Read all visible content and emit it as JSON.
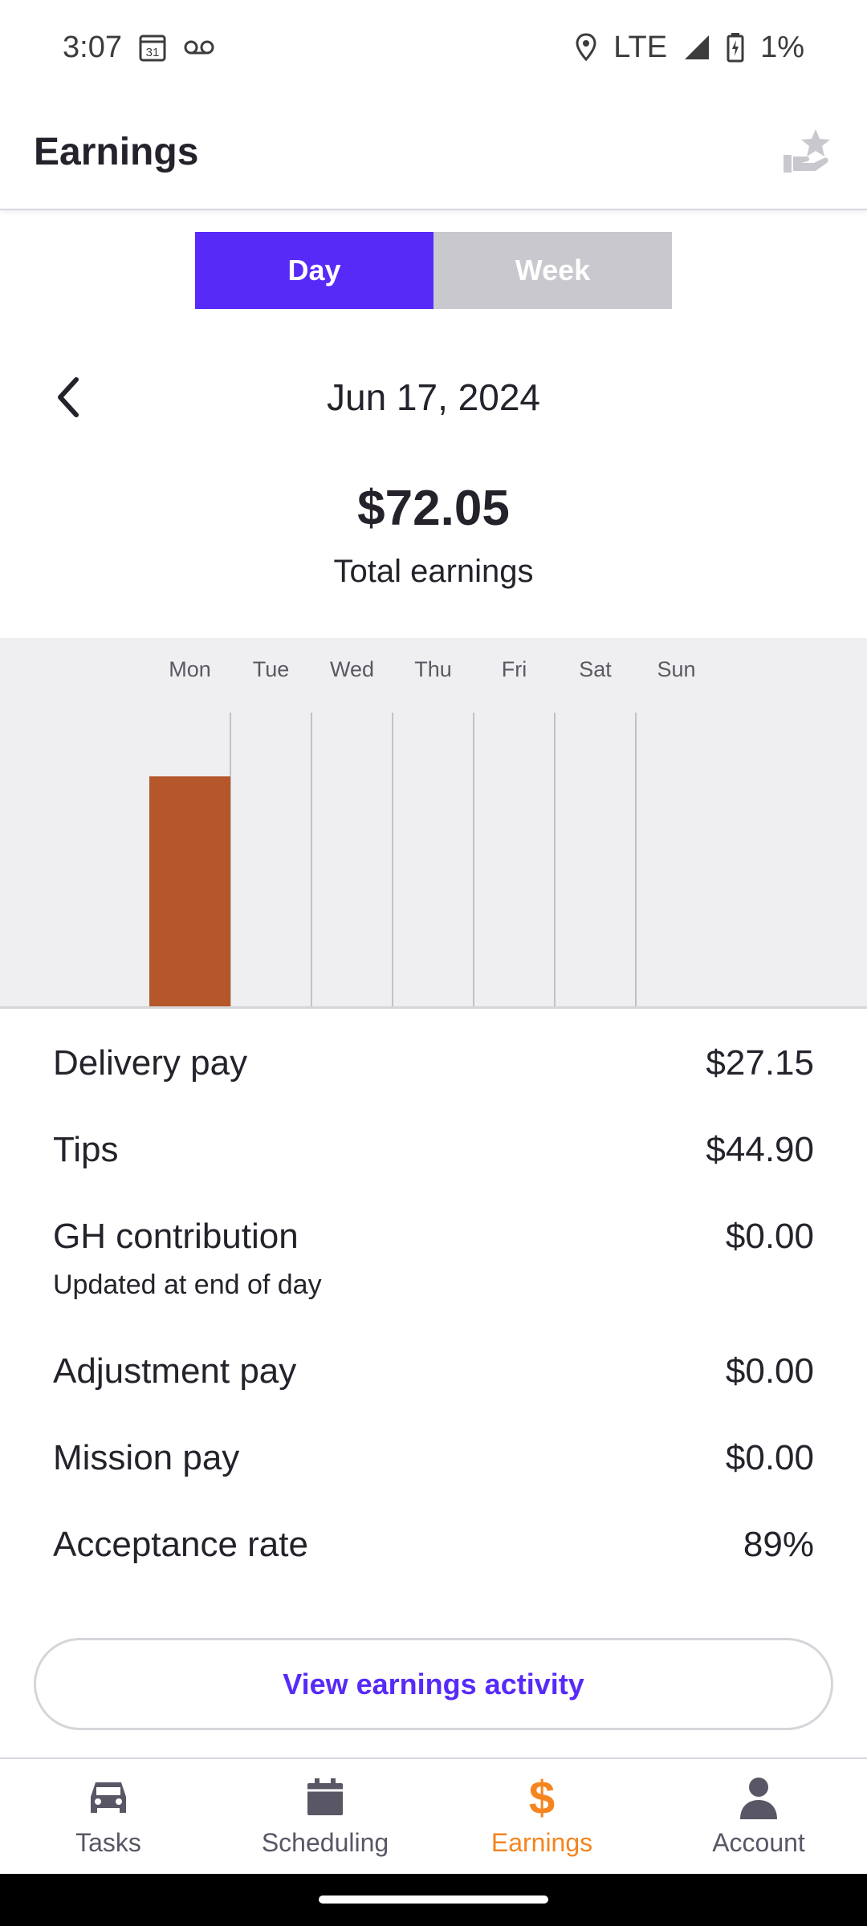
{
  "status_bar": {
    "time": "3:07",
    "calendar_day": "31",
    "network": "LTE",
    "battery": "1%",
    "icons": [
      "calendar-icon",
      "voicemail-icon",
      "location-icon",
      "signal-icon",
      "battery-icon"
    ]
  },
  "header": {
    "title": "Earnings",
    "action_icon": "rate-star-hand-icon"
  },
  "period_toggle": {
    "day_label": "Day",
    "week_label": "Week",
    "selected": "Day"
  },
  "date_nav": {
    "date": "Jun 17, 2024",
    "back_icon": "chevron-left-icon"
  },
  "summary": {
    "total": "$72.05",
    "label": "Total earnings"
  },
  "chart_data": {
    "type": "bar",
    "categories": [
      "Mon",
      "Tue",
      "Wed",
      "Thu",
      "Fri",
      "Sat",
      "Sun"
    ],
    "values": [
      72.05,
      0,
      0,
      0,
      0,
      0,
      0
    ],
    "ylim": [
      0,
      92
    ],
    "bar_color": "#b5572a",
    "grid": true,
    "background": "#efeff1"
  },
  "breakdown": {
    "rows": [
      {
        "label": "Delivery pay",
        "value": "$27.15",
        "sub": ""
      },
      {
        "label": "Tips",
        "value": "$44.90",
        "sub": ""
      },
      {
        "label": "GH contribution",
        "value": "$0.00",
        "sub": "Updated at end of day"
      },
      {
        "label": "Adjustment pay",
        "value": "$0.00",
        "sub": ""
      },
      {
        "label": "Mission pay",
        "value": "$0.00",
        "sub": ""
      },
      {
        "label": "Acceptance rate",
        "value": "89%",
        "sub": ""
      }
    ]
  },
  "view_activity_label": "View earnings activity",
  "bottom_nav": {
    "items": [
      {
        "label": "Tasks",
        "icon": "car-icon"
      },
      {
        "label": "Scheduling",
        "icon": "calendar-icon"
      },
      {
        "label": "Earnings",
        "icon": "dollar-icon"
      },
      {
        "label": "Account",
        "icon": "person-icon"
      }
    ],
    "active": "Earnings"
  },
  "colors": {
    "accent": "#572af8",
    "active_nav": "#f6841f",
    "bar": "#b5572a"
  }
}
